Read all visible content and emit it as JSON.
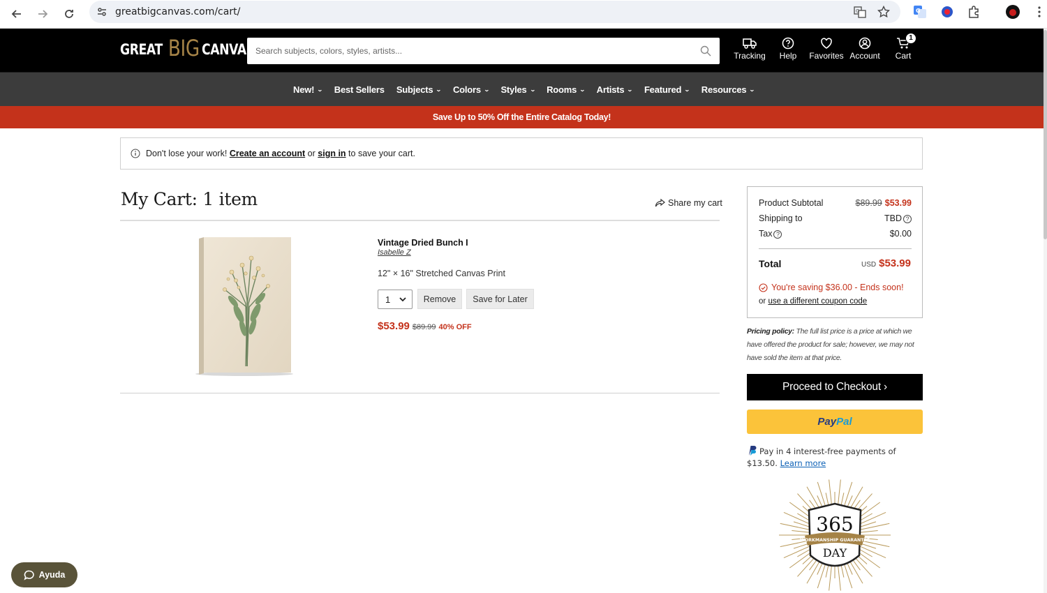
{
  "browser": {
    "url": "greatbigcanvas.com/cart/"
  },
  "header": {
    "logo": {
      "great": "GREAT",
      "big": "BIG",
      "canvas": "CANVAS."
    },
    "search_placeholder": "Search subjects, colors, styles, artists...",
    "icons": [
      {
        "label": "Tracking",
        "icon": "truck-icon"
      },
      {
        "label": "Help",
        "icon": "help-icon"
      },
      {
        "label": "Favorites",
        "icon": "heart-icon"
      },
      {
        "label": "Account",
        "icon": "account-icon"
      },
      {
        "label": "Cart",
        "icon": "cart-icon",
        "badge": "1"
      }
    ]
  },
  "nav": {
    "items": [
      {
        "label": "New!",
        "dropdown": true
      },
      {
        "label": "Best Sellers",
        "dropdown": false
      },
      {
        "label": "Subjects",
        "dropdown": true
      },
      {
        "label": "Colors",
        "dropdown": true
      },
      {
        "label": "Styles",
        "dropdown": true
      },
      {
        "label": "Rooms",
        "dropdown": true
      },
      {
        "label": "Artists",
        "dropdown": true
      },
      {
        "label": "Featured",
        "dropdown": true
      },
      {
        "label": "Resources",
        "dropdown": true
      }
    ]
  },
  "promo": "Save Up to 50% Off the Entire Catalog Today!",
  "notice": {
    "prefix": "Don't lose your work!",
    "create_account": "Create an account",
    "or": "or",
    "sign_in": "sign in",
    "suffix": "to save your cart."
  },
  "cart": {
    "title": "My Cart: 1 item",
    "share": "Share my cart",
    "item": {
      "name": "Vintage Dried Bunch I",
      "artist": "Isabelle Z",
      "size": "12\" × 16\" Stretched Canvas Print",
      "qty": "1",
      "remove": "Remove",
      "save_later": "Save for Later",
      "price": "$53.99",
      "was": "$89.99",
      "off": "40% OFF"
    }
  },
  "summary": {
    "subtotal_label": "Product Subtotal",
    "subtotal_was": "$89.99",
    "subtotal_now": "$53.99",
    "shipping_label": "Shipping to",
    "shipping_value": "TBD",
    "tax_label": "Tax",
    "tax_value": "$0.00",
    "total_label": "Total",
    "total_currency": "USD",
    "total_value": "$53.99",
    "saving": "You're saving $36.00 - Ends soon!",
    "coupon_or": "or",
    "coupon_link": "use a different coupon code"
  },
  "policy": {
    "label": "Pricing policy:",
    "text": "The full list price is a price at which we have offered the product for sale; however, we may not have sold the item at that price."
  },
  "checkout": "Proceed to Checkout ›",
  "paypal": {
    "pay": "Pay",
    "pal": "Pal"
  },
  "paylater": {
    "text": "Pay in 4 interest-free payments of $13.50.",
    "link": "Learn more"
  },
  "guarantee": {
    "num": "365",
    "band": "WORKMANSHIP GUARANTEE",
    "day": "DAY"
  },
  "chat": "Ayuda",
  "colors": {
    "brand_red": "#c4321b",
    "brand_gold": "#a58347",
    "paypal_yellow": "#fbc33a"
  }
}
